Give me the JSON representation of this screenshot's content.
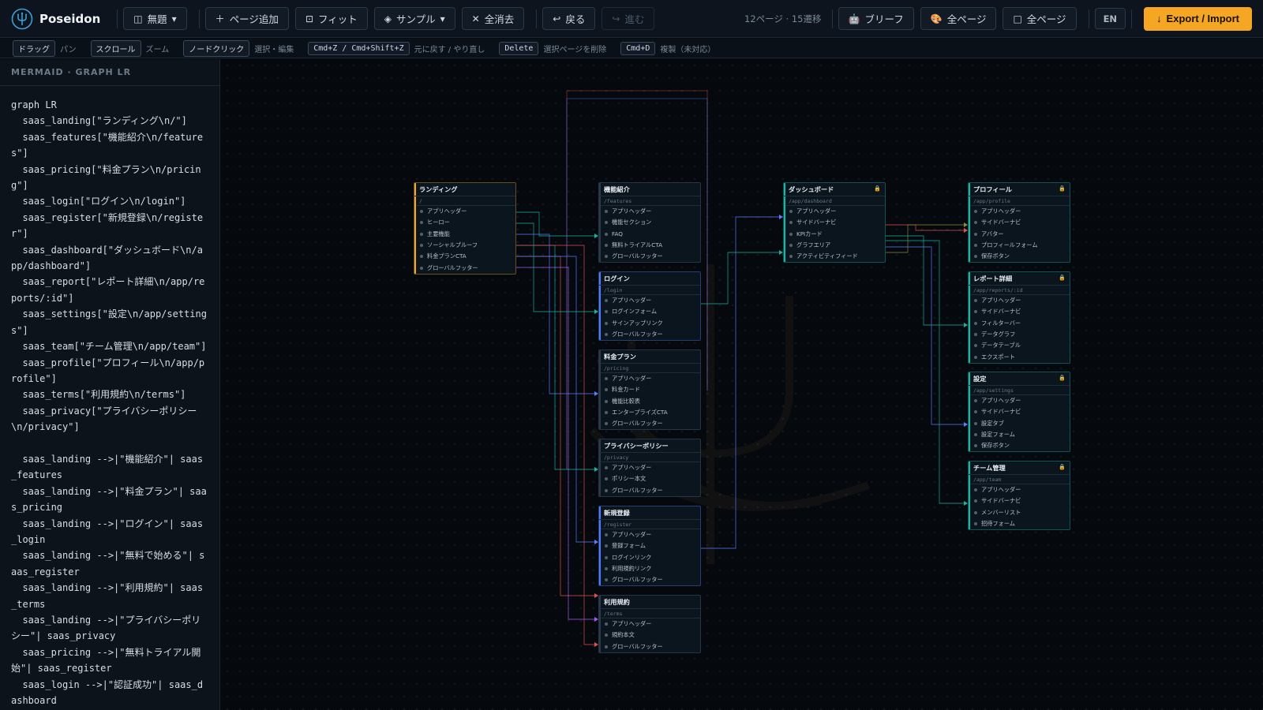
{
  "app": {
    "name": "Poseidon"
  },
  "toolbar": {
    "project": "無題",
    "add_page": "ページ追加",
    "fit": "フィット",
    "sample": "サンプル",
    "clear": "全消去",
    "undo": "戻る",
    "redo": "進む",
    "stats": "12ページ · 15遷移",
    "brief": "ブリーフ",
    "paint_all": "全ページ",
    "select_all": "全ページ",
    "lang": "EN",
    "export": "Export / Import"
  },
  "shortcuts": [
    {
      "key": "ドラッグ",
      "desc": "パン"
    },
    {
      "key": "スクロール",
      "desc": "ズーム"
    },
    {
      "key": "ノードクリック",
      "desc": "選択・編集"
    },
    {
      "key": "Cmd+Z / Cmd+Shift+Z",
      "desc": "元に戻す / やり直し"
    },
    {
      "key": "Delete",
      "desc": "選択ページを削除"
    },
    {
      "key": "Cmd+D",
      "desc": "複製（未対応）"
    }
  ],
  "code": {
    "title": "MERMAID · GRAPH LR",
    "text": "graph LR\n  saas_landing[\"ランディング\\n/\"]\n  saas_features[\"機能紹介\\n/features\"]\n  saas_pricing[\"料金プラン\\n/pricing\"]\n  saas_login[\"ログイン\\n/login\"]\n  saas_register[\"新規登録\\n/register\"]\n  saas_dashboard[\"ダッシュボード\\n/app/dashboard\"]\n  saas_report[\"レポート詳細\\n/app/reports/:id\"]\n  saas_settings[\"設定\\n/app/settings\"]\n  saas_team[\"チーム管理\\n/app/team\"]\n  saas_profile[\"プロフィール\\n/app/profile\"]\n  saas_terms[\"利用規約\\n/terms\"]\n  saas_privacy[\"プライバシーポリシー\\n/privacy\"]\n\n  saas_landing -->|\"機能紹介\"| saas_features\n  saas_landing -->|\"料金プラン\"| saas_pricing\n  saas_landing -->|\"ログイン\"| saas_login\n  saas_landing -->|\"無料で始める\"| saas_register\n  saas_landing -->|\"利用規約\"| saas_terms\n  saas_landing -->|\"プライバシーポリシー\"| saas_privacy\n  saas_pricing -->|\"無料トライアル開始\"| saas_register\n  saas_login -->|\"認証成功\"| saas_dashboard"
  },
  "colors": {
    "accent_orange": "#f5a623",
    "accent_blue": "#4d7cff",
    "accent_teal": "#14b8a6",
    "accent_purple": "#a855f7",
    "edge_red": "#e0524a",
    "edge_teal": "#17b2a0",
    "edge_blue": "#5b7cff",
    "edge_purple": "#a35cf0",
    "edge_olive": "#8c8a3a"
  },
  "nodes": [
    {
      "id": "landing",
      "title": "ランディング",
      "route": "/",
      "accent": "#f5a623",
      "locked": false,
      "items": [
        "アプリヘッダー",
        "ヒーロー",
        "主要機能",
        "ソーシャルプルーフ",
        "料金プランCTA",
        "グローバルフッター"
      ]
    },
    {
      "id": "features",
      "title": "機能紹介",
      "route": "/features",
      "accent": "#2a3a4a",
      "locked": false,
      "items": [
        "アプリヘッダー",
        "機能セクション",
        "FAQ",
        "無料トライアルCTA",
        "グローバルフッター"
      ]
    },
    {
      "id": "login",
      "title": "ログイン",
      "route": "/login",
      "accent": "#4d7cff",
      "locked": false,
      "items": [
        "アプリヘッダー",
        "ログインフォーム",
        "サインアップリンク",
        "グローバルフッター"
      ]
    },
    {
      "id": "pricing",
      "title": "料金プラン",
      "route": "/pricing",
      "accent": "#2a3a4a",
      "locked": false,
      "items": [
        "アプリヘッダー",
        "料金カード",
        "機能比較表",
        "エンタープライズCTA",
        "グローバルフッター"
      ]
    },
    {
      "id": "privacy",
      "title": "プライバシーポリシー",
      "route": "/privacy",
      "accent": "#2a3a4a",
      "locked": false,
      "items": [
        "アプリヘッダー",
        "ポリシー本文",
        "グローバルフッター"
      ]
    },
    {
      "id": "register",
      "title": "新規登録",
      "route": "/register",
      "accent": "#4d7cff",
      "locked": false,
      "items": [
        "アプリヘッダー",
        "登録フォーム",
        "ログインリンク",
        "利用規約リンク",
        "グローバルフッター"
      ]
    },
    {
      "id": "terms",
      "title": "利用規約",
      "route": "/terms",
      "accent": "#2a3a4a",
      "locked": false,
      "items": [
        "アプリヘッダー",
        "規約本文",
        "グローバルフッター"
      ]
    },
    {
      "id": "dashboard",
      "title": "ダッシュボード",
      "route": "/app/dashboard",
      "accent": "#14b8a6",
      "locked": true,
      "items": [
        "アプリヘッダー",
        "サイドバーナビ",
        "KPIカード",
        "グラフエリア",
        "アクティビティフィード"
      ]
    },
    {
      "id": "profile",
      "title": "プロフィール",
      "route": "/app/profile",
      "accent": "#14b8a6",
      "locked": true,
      "items": [
        "アプリヘッダー",
        "サイドバーナビ",
        "アバター",
        "プロフィールフォーム",
        "保存ボタン"
      ]
    },
    {
      "id": "report",
      "title": "レポート詳細",
      "route": "/app/reports/:id",
      "accent": "#14b8a6",
      "locked": true,
      "items": [
        "アプリヘッダー",
        "サイドバーナビ",
        "フィルターバー",
        "データグラフ",
        "データテーブル",
        "エクスポート"
      ]
    },
    {
      "id": "settings",
      "title": "設定",
      "route": "/app/settings",
      "accent": "#14b8a6",
      "locked": true,
      "items": [
        "アプリヘッダー",
        "サイドバーナビ",
        "設定タブ",
        "設定フォーム",
        "保存ボタン"
      ]
    },
    {
      "id": "team",
      "title": "チーム管理",
      "route": "/app/team",
      "accent": "#14b8a6",
      "locked": true,
      "items": [
        "アプリヘッダー",
        "サイドバーナビ",
        "メンバーリスト",
        "招待フォーム"
      ]
    }
  ]
}
